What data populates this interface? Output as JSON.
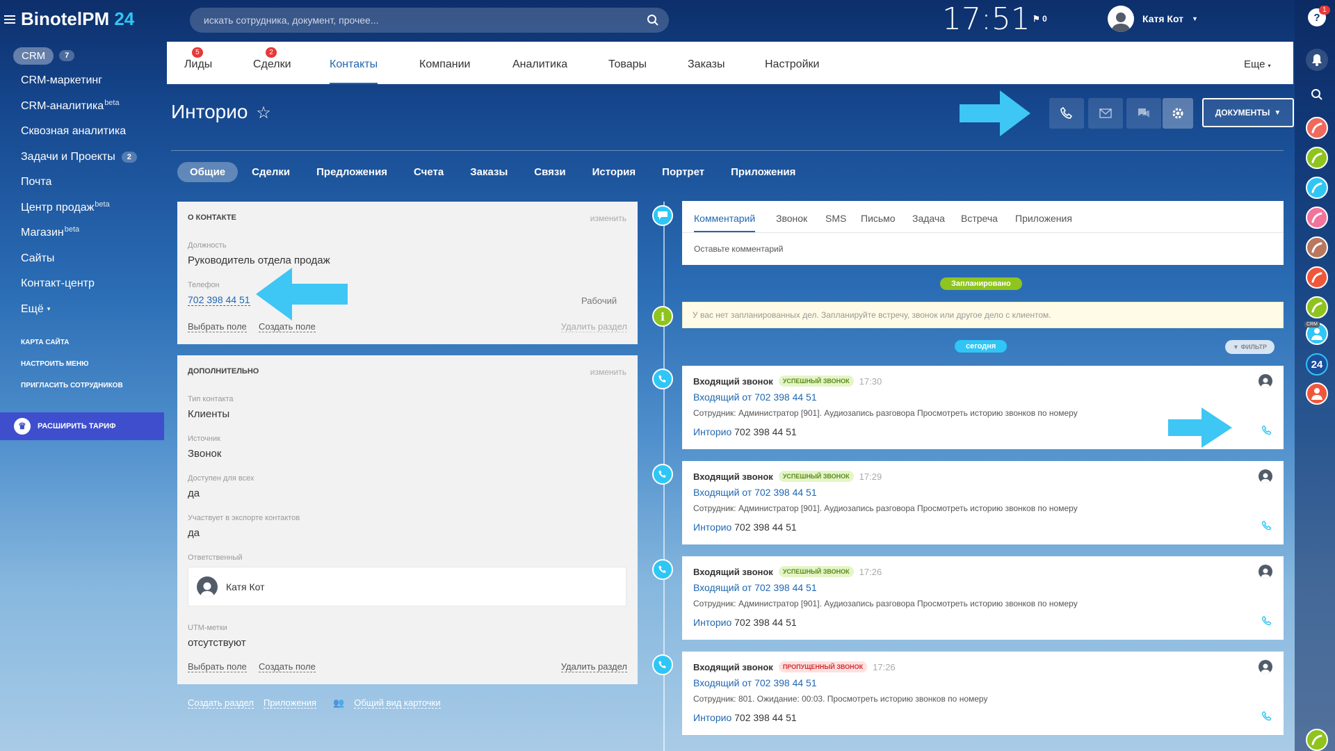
{
  "app": {
    "logo_main": "BinotelPM",
    "logo_num": "24"
  },
  "header": {
    "search_placeholder": "искать сотрудника, документ, прочее...",
    "time": "17:51",
    "flag_count": "0",
    "user_name": "Катя Кот"
  },
  "sidebar": {
    "crm_label": "CRM",
    "crm_count": "7",
    "items": [
      {
        "label": "CRM-маркетинг"
      },
      {
        "label": "CRM-аналитика",
        "sup": "beta"
      },
      {
        "label": "Сквозная аналитика"
      },
      {
        "label": "Задачи и Проекты",
        "count": "2"
      },
      {
        "label": "Почта"
      },
      {
        "label": "Центр продаж",
        "sup": "beta"
      },
      {
        "label": "Магазин",
        "sup": "beta"
      },
      {
        "label": "Сайты"
      },
      {
        "label": "Контакт-центр"
      },
      {
        "label": "Ещё"
      }
    ],
    "small": [
      "КАРТА САЙТА",
      "НАСТРОИТЬ МЕНЮ",
      "ПРИГЛАСИТЬ СОТРУДНИКОВ"
    ],
    "upgrade": "РАСШИРИТЬ ТАРИФ"
  },
  "top_tabs": [
    {
      "label": "Лиды",
      "badge": "5"
    },
    {
      "label": "Сделки",
      "badge": "2"
    },
    {
      "label": "Контакты",
      "active": true
    },
    {
      "label": "Компании"
    },
    {
      "label": "Аналитика"
    },
    {
      "label": "Товары"
    },
    {
      "label": "Заказы"
    },
    {
      "label": "Настройки"
    },
    {
      "label": "Еще"
    }
  ],
  "page": {
    "title": "Инторио",
    "docs_button": "ДОКУМЕНТЫ"
  },
  "sub_tabs": [
    "Общие",
    "Сделки",
    "Предложения",
    "Счета",
    "Заказы",
    "Связи",
    "История",
    "Портрет",
    "Приложения"
  ],
  "about": {
    "header": "О КОНТАКТЕ",
    "edit": "изменить",
    "position_label": "Должность",
    "position_value": "Руководитель отдела продаж",
    "phone_label": "Телефон",
    "phone_value": "702 398 44 51",
    "phone_type": "Рабочий",
    "select_field": "Выбрать поле",
    "create_field": "Создать поле",
    "delete_section": "Удалить раздел"
  },
  "extra": {
    "header": "ДОПОЛНИТЕЛЬНО",
    "edit": "изменить",
    "fields": [
      {
        "label": "Тип контакта",
        "value": "Клиенты"
      },
      {
        "label": "Источник",
        "value": "Звонок"
      },
      {
        "label": "Доступен для всех",
        "value": "да"
      },
      {
        "label": "Участвует в экспорте контактов",
        "value": "да"
      }
    ],
    "responsible_label": "Ответственный",
    "responsible_name": "Катя Кот",
    "utm_label": "UTM-метки",
    "utm_value": "отсутствуют",
    "select_field": "Выбрать поле",
    "create_field": "Создать поле",
    "delete_section": "Удалить раздел"
  },
  "bottom_links": {
    "create_section": "Создать раздел",
    "apps": "Приложения",
    "common_view": "Общий вид карточки"
  },
  "timeline": {
    "editor_tabs": [
      "Комментарий",
      "Звонок",
      "SMS",
      "Письмо",
      "Задача",
      "Встреча",
      "Приложения"
    ],
    "editor_hint": "Оставьте комментарий",
    "planned_badge": "Запланировано",
    "planned_text": "У вас нет запланированных дел. Запланируйте встречу, звонок или другое дело с клиентом.",
    "today_badge": "сегодня",
    "filter": "ФИЛЬТР",
    "calls": [
      {
        "title": "Входящий звонок",
        "status": "УСПЕШНЫЙ ЗВОНОК",
        "missed": false,
        "time": "17:30",
        "link": "Входящий от 702 398 44 51",
        "desc": "Сотрудник: Администратор [901]. Аудиозапись разговора Просмотреть историю звонков по номеру",
        "contact": "Инторио",
        "phone": "702 398 44 51"
      },
      {
        "title": "Входящий звонок",
        "status": "УСПЕШНЫЙ ЗВОНОК",
        "missed": false,
        "time": "17:29",
        "link": "Входящий от 702 398 44 51",
        "desc": "Сотрудник: Администратор [901]. Аудиозапись разговора Просмотреть историю звонков по номеру",
        "contact": "Инторио",
        "phone": "702 398 44 51"
      },
      {
        "title": "Входящий звонок",
        "status": "УСПЕШНЫЙ ЗВОНОК",
        "missed": false,
        "time": "17:26",
        "link": "Входящий от 702 398 44 51",
        "desc": "Сотрудник: Администратор [901]. Аудиозапись разговора Просмотреть историю звонков по номеру",
        "contact": "Инторио",
        "phone": "702 398 44 51"
      },
      {
        "title": "Входящий звонок",
        "status": "ПРОПУЩЕННЫЙ ЗВОНОК",
        "missed": true,
        "time": "17:26",
        "link": "Входящий от 702 398 44 51",
        "desc": "Сотрудник: 801. Ожидание: 00:03. Просмотреть историю звонков по номеру",
        "contact": "Инторио",
        "phone": "702 398 44 51"
      }
    ]
  },
  "right_rail": {
    "help_badge": "1",
    "crm_mini": "CRM",
    "b24": "24"
  },
  "colors": {
    "accent": "#2fc6f6",
    "link": "#2067b0",
    "planned": "#8fc41e",
    "today": "#2fc6f6",
    "missed": "#d03030",
    "success": "#5c8a1a",
    "upgrade": "#3e4ecd"
  }
}
